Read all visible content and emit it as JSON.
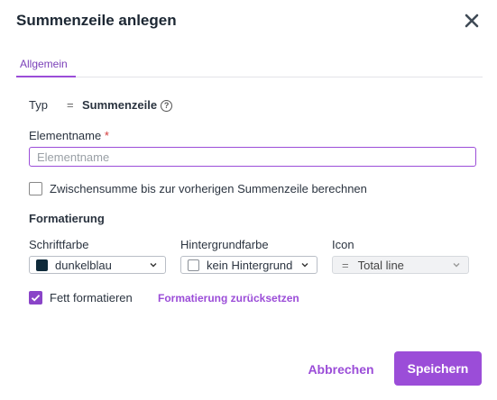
{
  "dialog": {
    "title": "Summenzeile anlegen",
    "close_icon": "close-icon"
  },
  "tabs": [
    {
      "label": "Allgemein",
      "active": true
    }
  ],
  "type_row": {
    "label": "Typ",
    "equals": "=",
    "value": "Summenzeile",
    "help_icon": "question-circle-icon"
  },
  "name_field": {
    "label": "Elementname",
    "required_mark": "*",
    "placeholder": "Elementname",
    "value": ""
  },
  "subtotal_checkbox": {
    "label": "Zwischensumme bis zur vorherigen Summenzeile berechnen",
    "checked": false
  },
  "formatting": {
    "heading": "Formatierung",
    "font_color": {
      "label": "Schriftfarbe",
      "value": "dunkelblau",
      "swatch_color": "#0f2a3a"
    },
    "background_color": {
      "label": "Hintergrundfarbe",
      "value": "kein Hintergrund",
      "swatch_color": "#ffffff"
    },
    "icon": {
      "label": "Icon",
      "prefix": "=",
      "value": "Total line",
      "disabled": true
    },
    "bold_checkbox": {
      "label": "Fett formatieren",
      "checked": true
    },
    "reset_link": "Formatierung zurücksetzen"
  },
  "footer": {
    "cancel_label": "Abbrechen",
    "save_label": "Speichern"
  },
  "colors": {
    "accent": "#9b4dd8",
    "title": "#1c2733"
  }
}
